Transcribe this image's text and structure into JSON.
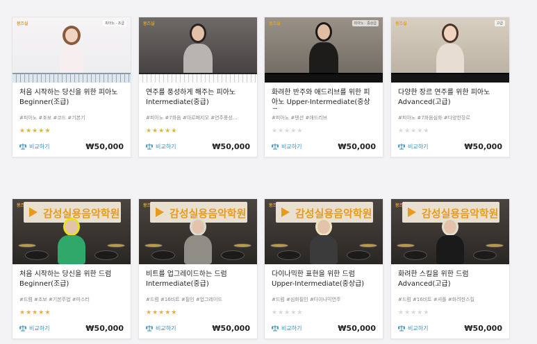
{
  "courses": [
    {
      "title": "처음 시작하는 당신을 위한 피아노 Beginner(조급)",
      "tags": "#피아노 #조보 #코드 #기본기",
      "rating": 5,
      "compare_label": "비교하기",
      "price": "₩50,000",
      "thumb_logo": "몽즈실",
      "thumb_tag": "피아노 · 조급"
    },
    {
      "title": "연주를 풍성하게 해주는 피아노 Intermediate(중급)",
      "tags": "#피아노 #7화음 #아르페지오 #연주풍성...",
      "rating": 5,
      "compare_label": "비교하기",
      "price": "₩50,000",
      "thumb_logo": "몽즈실",
      "thumb_tag": ""
    },
    {
      "title": "화려한 반주와 애드리브를 위한 피아노 Upper-Intermediate(중상급)",
      "tags": "#피아노 #텐션 #애드리브",
      "rating": 0,
      "compare_label": "비교하기",
      "price": "₩50,000",
      "thumb_logo": "몽즈실",
      "thumb_tag": "피아노 · 중상급"
    },
    {
      "title": "다양한 장르 연주를 위한 피아노 Advanced(고급)",
      "tags": "#피아노 #7화음심화 #다양한장르",
      "rating": 0,
      "compare_label": "비교하기",
      "price": "₩50,000",
      "thumb_logo": "몽즈실",
      "thumb_tag": "고급"
    },
    {
      "title": "처음 시작하는 당신을 위한 드럼 Beginner(조급)",
      "tags": "#드럼 #조보 #기본주법 #마스터",
      "rating": 5,
      "compare_label": "비교하기",
      "price": "₩50,000",
      "thumb_logo": "몽즈실",
      "thumb_tag": "",
      "banner": "감성실용음악학원"
    },
    {
      "title": "비트를 업그레이드하는 드럼 Intermediate(중급)",
      "tags": "#드럼 #16비트 #필인 #업그레이드",
      "rating": 5,
      "compare_label": "비교하기",
      "price": "₩50,000",
      "thumb_logo": "몽즈실",
      "thumb_tag": "",
      "banner": "감성실용음악학원"
    },
    {
      "title": "다이나믹한 표현을 위한 드럼 Upper-Intermediate(중상급)",
      "tags": "#드럼 #심화필인 #다이나믹연주",
      "rating": 0,
      "compare_label": "비교하기",
      "price": "₩50,000",
      "thumb_logo": "몽즈실",
      "thumb_tag": "",
      "banner": "감성실용음악학원"
    },
    {
      "title": "화려한 스킬을 위한 드럼 Advanced(고급)",
      "tags": "#드럼 #16비트 #셔플 #화려한스킬",
      "rating": 0,
      "compare_label": "비교하기",
      "price": "₩50,000",
      "thumb_logo": "몽즈실",
      "thumb_tag": "",
      "banner": "감성실용음악학원"
    }
  ],
  "colors": {
    "star_on": "#f2b01e",
    "star_off": "#d8d8d8",
    "compare": "#3a8fb7",
    "brand_orange": "#e89a1c"
  }
}
